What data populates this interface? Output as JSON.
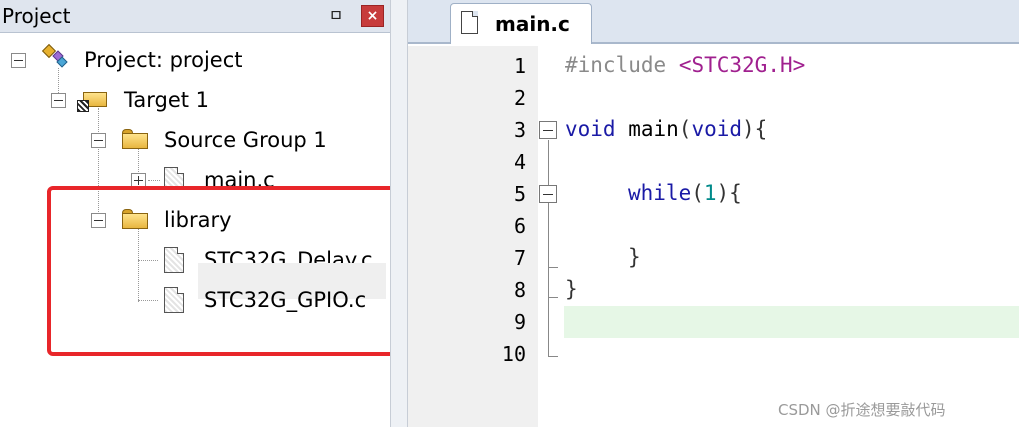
{
  "project_pane": {
    "title": "Project",
    "pin_icon": "pin-icon",
    "close_icon": "close-icon",
    "pin_glyph": "ㅁ",
    "close_glyph": "×",
    "tree": {
      "project": "Project: project",
      "target": "Target 1",
      "source_group": "Source Group 1",
      "main_file": "main.c",
      "library": "library",
      "delay_file": "STC32G_Delay.c",
      "gpio_file": "STC32G_GPIO.c"
    }
  },
  "editor": {
    "tab_label": "main.c",
    "line_numbers": [
      "1",
      "2",
      "3",
      "4",
      "5",
      "6",
      "7",
      "8",
      "9",
      "10"
    ],
    "code": {
      "l1_directive": "#include",
      "l1_header": "<STC32G.H>",
      "l3_kw1": "void",
      "l3_name": " main",
      "l3_open": "(",
      "l3_kw2": "void",
      "l3_close": "){",
      "l5_kw": "while",
      "l5_open": "(",
      "l5_num": "1",
      "l5_close": "){",
      "l7_brace": "}",
      "l8_brace": "}"
    }
  },
  "watermark": "CSDN @折途想要敲代码",
  "colors": {
    "keyword": "#1a1aa6",
    "include_header": "#a0208f",
    "number": "#008a8a",
    "current_line": "#e6f7e6",
    "annotation_box": "#e8262a"
  }
}
